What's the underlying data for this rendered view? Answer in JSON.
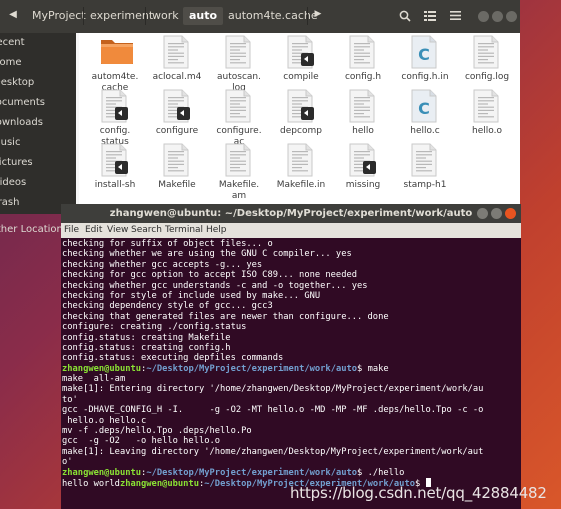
{
  "file_manager": {
    "breadcrumbs": [
      "MyProject",
      "experiment",
      "work",
      "auto",
      "autom4te.cache"
    ],
    "active_crumb": "auto",
    "sidebar": [
      "Recent",
      "Home",
      "Desktop",
      "Documents",
      "Downloads",
      "Music",
      "Pictures",
      "Videos",
      "Trash",
      "Other Locations"
    ],
    "files": [
      {
        "name": "autom4te.\ncache",
        "kind": "folder"
      },
      {
        "name": "aclocal.m4",
        "kind": "text"
      },
      {
        "name": "autoscan.\nlog",
        "kind": "text"
      },
      {
        "name": "compile",
        "kind": "script"
      },
      {
        "name": "config.h",
        "kind": "text"
      },
      {
        "name": "config.h.in",
        "kind": "c"
      },
      {
        "name": "config.log",
        "kind": "text"
      },
      {
        "name": "config.\nstatus",
        "kind": "script"
      },
      {
        "name": "configure",
        "kind": "script"
      },
      {
        "name": "configure.\nac",
        "kind": "text"
      },
      {
        "name": "depcomp",
        "kind": "script"
      },
      {
        "name": "hello",
        "kind": "text"
      },
      {
        "name": "hello.c",
        "kind": "c"
      },
      {
        "name": "hello.o",
        "kind": "text"
      },
      {
        "name": "install-sh",
        "kind": "script"
      },
      {
        "name": "Makefile",
        "kind": "text"
      },
      {
        "name": "Makefile.\nam",
        "kind": "text"
      },
      {
        "name": "Makefile.in",
        "kind": "text"
      },
      {
        "name": "missing",
        "kind": "script"
      },
      {
        "name": "stamp-h1",
        "kind": "text"
      }
    ]
  },
  "terminal": {
    "title": "zhangwen@ubuntu: ~/Desktop/MyProject/experiment/work/auto",
    "menu": [
      "File",
      "Edit",
      "View",
      "Search",
      "Terminal",
      "Help"
    ],
    "lines": [
      {
        "text": "checking for suffix of object files... o"
      },
      {
        "text": "checking whether we are using the GNU C compiler... yes"
      },
      {
        "text": "checking whether gcc accepts -g... yes"
      },
      {
        "text": "checking for gcc option to accept ISO C89... none needed"
      },
      {
        "text": "checking whether gcc understands -c and -o together... yes"
      },
      {
        "text": "checking for style of include used by make... GNU"
      },
      {
        "text": "checking dependency style of gcc... gcc3"
      },
      {
        "text": "checking that generated files are newer than configure... done"
      },
      {
        "text": "configure: creating ./config.status"
      },
      {
        "text": "config.status: creating Makefile"
      },
      {
        "text": "config.status: creating config.h"
      },
      {
        "text": "config.status: executing depfiles commands"
      },
      {
        "prompt": true,
        "user": "zhangwen@ubuntu",
        "path": "~/Desktop/MyProject/experiment/work/auto",
        "cmd": " make"
      },
      {
        "text": "make  all-am"
      },
      {
        "text": "make[1]: Entering directory '/home/zhangwen/Desktop/MyProject/experiment/work/au"
      },
      {
        "text": "to'"
      },
      {
        "text": "gcc -DHAVE_CONFIG_H -I.     -g -O2 -MT hello.o -MD -MP -MF .deps/hello.Tpo -c -o"
      },
      {
        "text": " hello.o hello.c"
      },
      {
        "text": "mv -f .deps/hello.Tpo .deps/hello.Po"
      },
      {
        "text": "gcc  -g -O2   -o hello hello.o"
      },
      {
        "text": "make[1]: Leaving directory '/home/zhangwen/Desktop/MyProject/experiment/work/aut"
      },
      {
        "text": "o'"
      },
      {
        "prompt": true,
        "user": "zhangwen@ubuntu",
        "path": "~/Desktop/MyProject/experiment/work/auto",
        "cmd": " ./hello"
      },
      {
        "prefix": "hello world",
        "prompt": true,
        "user": "zhangwen@ubuntu",
        "path": "~/Desktop/MyProject/experiment/work/auto",
        "cmd": " ",
        "cursor": true
      }
    ]
  },
  "watermark": "https://blog.csdn.net/qq_42884482"
}
